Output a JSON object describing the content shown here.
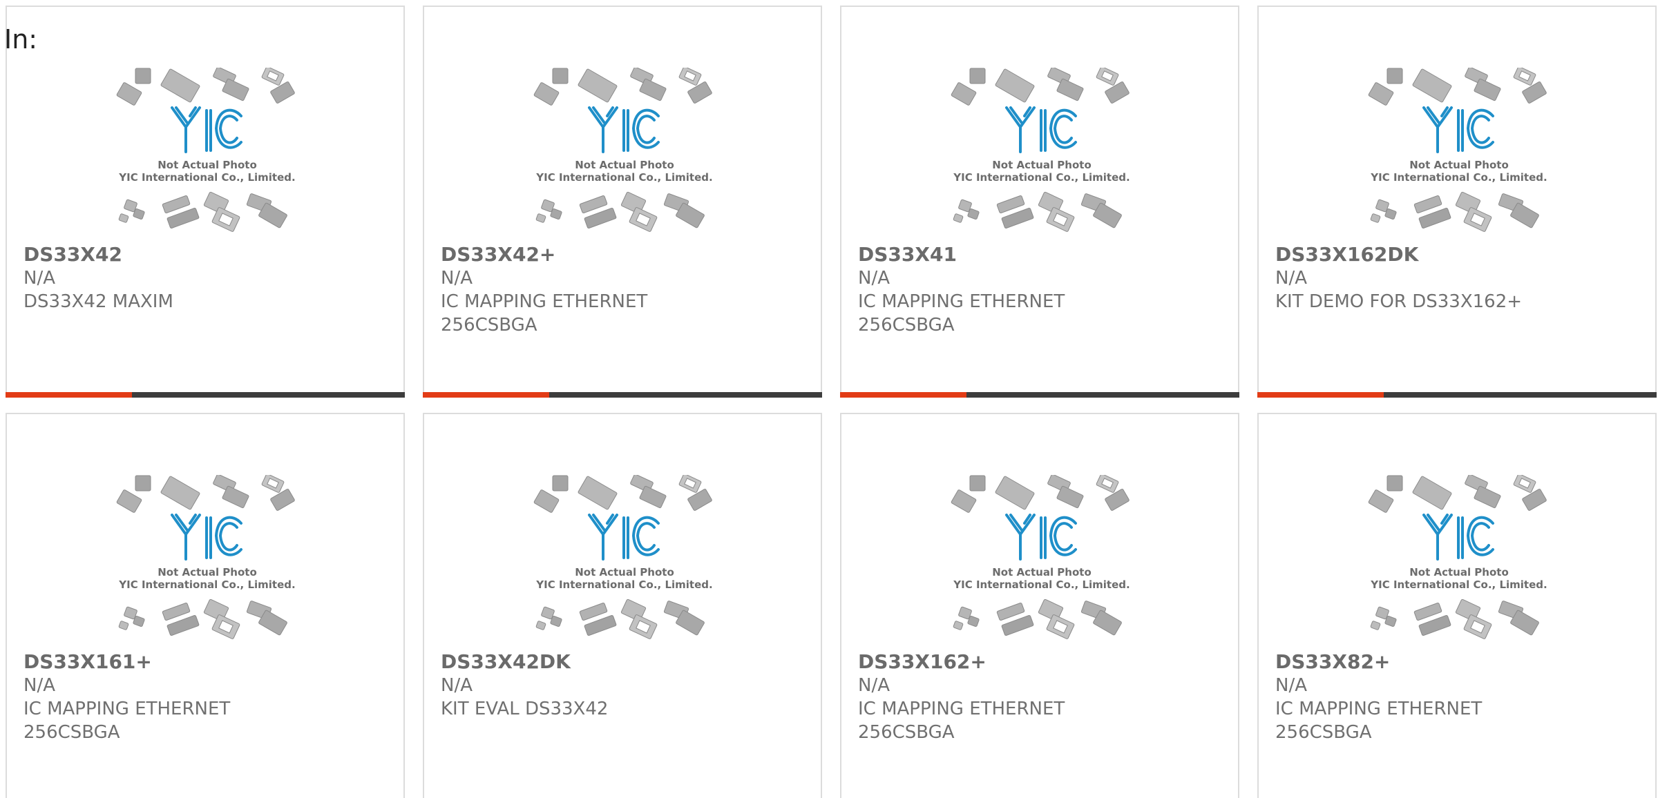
{
  "header": {
    "in_label": "In:"
  },
  "placeholder": {
    "logo_text": "YIC",
    "caption_line1": "Not Actual Photo",
    "caption_line2": "YIC International Co., Limited.",
    "logo_color": "#1f8fc9",
    "chip_color": "#b0b0b0"
  },
  "colors": {
    "accent": "#e23c16",
    "bar_dark": "#3d3d3d",
    "card_border": "#dcdcdc",
    "text": "#707070"
  },
  "products": [
    {
      "part": "DS33X42",
      "mfr": "N/A",
      "desc_lines": [
        "DS33X42 MAXIM",
        ""
      ]
    },
    {
      "part": "DS33X42+",
      "mfr": "N/A",
      "desc_lines": [
        "IC MAPPING ETHERNET",
        "256CSBGA"
      ]
    },
    {
      "part": "DS33X41",
      "mfr": "N/A",
      "desc_lines": [
        "IC MAPPING ETHERNET",
        "256CSBGA"
      ]
    },
    {
      "part": "DS33X162DK",
      "mfr": "N/A",
      "desc_lines": [
        "KIT DEMO FOR DS33X162+",
        ""
      ]
    },
    {
      "part": "DS33X161+",
      "mfr": "N/A",
      "desc_lines": [
        "IC MAPPING ETHERNET",
        "256CSBGA"
      ]
    },
    {
      "part": "DS33X42DK",
      "mfr": "N/A",
      "desc_lines": [
        "KIT EVAL DS33X42",
        ""
      ]
    },
    {
      "part": "DS33X162+",
      "mfr": "N/A",
      "desc_lines": [
        "IC MAPPING ETHERNET",
        "256CSBGA"
      ]
    },
    {
      "part": "DS33X82+",
      "mfr": "N/A",
      "desc_lines": [
        "IC MAPPING ETHERNET",
        "256CSBGA"
      ]
    }
  ]
}
